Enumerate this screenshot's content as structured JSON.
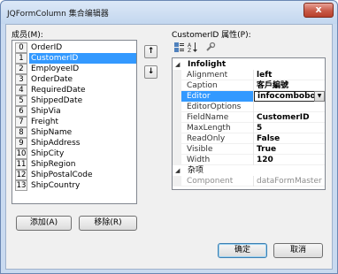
{
  "window": {
    "title": "JQFormColumn 集合编辑器",
    "close_label": "x"
  },
  "members": {
    "label": "成员(M):",
    "items": [
      {
        "index": "0",
        "name": "OrderID"
      },
      {
        "index": "1",
        "name": "CustomerID"
      },
      {
        "index": "2",
        "name": "EmployeeID"
      },
      {
        "index": "3",
        "name": "OrderDate"
      },
      {
        "index": "4",
        "name": "RequiredDate"
      },
      {
        "index": "5",
        "name": "ShippedDate"
      },
      {
        "index": "6",
        "name": "ShipVia"
      },
      {
        "index": "7",
        "name": "Freight"
      },
      {
        "index": "8",
        "name": "ShipName"
      },
      {
        "index": "9",
        "name": "ShipAddress"
      },
      {
        "index": "10",
        "name": "ShipCity"
      },
      {
        "index": "11",
        "name": "ShipRegion"
      },
      {
        "index": "12",
        "name": "ShipPostalCode"
      },
      {
        "index": "13",
        "name": "ShipCountry"
      }
    ],
    "selected_index": 1,
    "move_up_icon": "arrow-up-icon",
    "move_down_icon": "arrow-down-icon"
  },
  "properties": {
    "label": "CustomerID 属性(P):",
    "toolbar": {
      "categorized_icon": "categorized-icon",
      "alphabetical_icon": "alphabetical-icon",
      "property_pages_icon": "property-pages-icon"
    },
    "categories": [
      {
        "name": "Infolight",
        "rows": [
          {
            "name": "Alignment",
            "value": "left"
          },
          {
            "name": "Caption",
            "value": "客戶編號"
          },
          {
            "name": "Editor",
            "value": "infocombobox",
            "selected": true
          },
          {
            "name": "EditorOptions",
            "value": ""
          },
          {
            "name": "FieldName",
            "value": "CustomerID"
          },
          {
            "name": "MaxLength",
            "value": "5"
          },
          {
            "name": "ReadOnly",
            "value": "False"
          },
          {
            "name": "Visible",
            "value": "True"
          },
          {
            "name": "Width",
            "value": "120"
          }
        ]
      },
      {
        "name": "杂项",
        "rows": [
          {
            "name": "Component",
            "value": "dataFormMaster",
            "disabled": true
          }
        ]
      }
    ]
  },
  "buttons": {
    "add": "添加(A)",
    "remove": "移除(R)",
    "ok": "确定",
    "cancel": "取消"
  },
  "colors": {
    "selection": "#3399ff",
    "title_bar": "#c3d7ef",
    "close_button": "#c85a47"
  }
}
